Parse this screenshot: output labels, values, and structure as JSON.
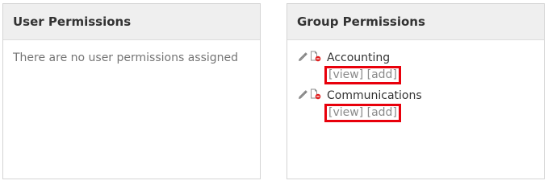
{
  "user_panel": {
    "title": "User Permissions",
    "empty_message": "There are no user permissions assigned"
  },
  "group_panel": {
    "title": "Group Permissions",
    "groups": [
      {
        "name": "Accounting",
        "view_label": "[view]",
        "add_label": "[add]"
      },
      {
        "name": "Communications",
        "view_label": "[view]",
        "add_label": "[add]"
      }
    ]
  },
  "icons": {
    "edit": "pencil-icon",
    "remove": "delete-document-icon"
  },
  "colors": {
    "highlight_border": "#e8000b",
    "header_bg": "#efefef",
    "panel_border": "#d4d4d4",
    "link": "#8a8a8a"
  }
}
